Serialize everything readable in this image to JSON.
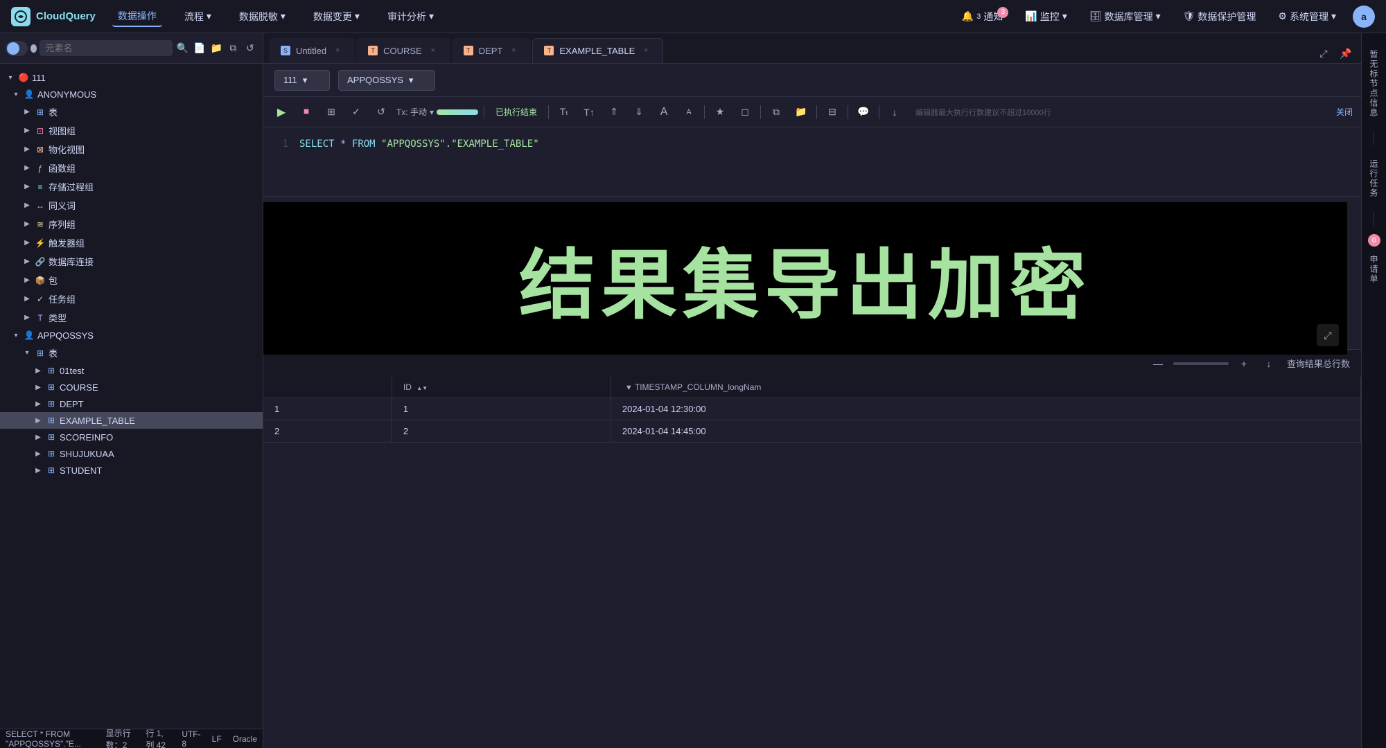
{
  "brand": {
    "name": "CloudQuery",
    "icon_text": "CQ"
  },
  "topnav": {
    "items": [
      {
        "label": "数据操作",
        "active": true
      },
      {
        "label": "流程",
        "dropdown": true
      },
      {
        "label": "数据脱敏",
        "dropdown": true
      },
      {
        "label": "数据变更",
        "dropdown": true
      },
      {
        "label": "审计分析",
        "dropdown": true
      }
    ],
    "right_items": [
      {
        "label": "通知",
        "badge": "3"
      },
      {
        "label": "监控",
        "dropdown": true
      },
      {
        "label": "数据库管理",
        "dropdown": true
      },
      {
        "label": "数据保护管理"
      },
      {
        "label": "系统管理",
        "dropdown": true
      }
    ]
  },
  "sidebar": {
    "search_placeholder": "元素名",
    "tree": [
      {
        "label": "111",
        "level": 0,
        "expanded": true,
        "icon": "db"
      },
      {
        "label": "ANONYMOUS",
        "level": 1,
        "expanded": true,
        "icon": "user"
      },
      {
        "label": "表",
        "level": 2,
        "expanded": false,
        "icon": "table"
      },
      {
        "label": "视图组",
        "level": 2,
        "expanded": false,
        "icon": "view"
      },
      {
        "label": "物化视图",
        "level": 2,
        "expanded": false,
        "icon": "mview"
      },
      {
        "label": "函数组",
        "level": 2,
        "expanded": false,
        "icon": "func"
      },
      {
        "label": "存储过程组",
        "level": 2,
        "expanded": false,
        "icon": "proc"
      },
      {
        "label": "同义词",
        "level": 2,
        "expanded": false,
        "icon": "syn"
      },
      {
        "label": "序列组",
        "level": 2,
        "expanded": false,
        "icon": "seq"
      },
      {
        "label": "触发器组",
        "level": 2,
        "expanded": false,
        "icon": "trig"
      },
      {
        "label": "数据库连接",
        "level": 2,
        "expanded": false,
        "icon": "conn"
      },
      {
        "label": "包",
        "level": 2,
        "expanded": false,
        "icon": "pkg"
      },
      {
        "label": "任务组",
        "level": 2,
        "expanded": false,
        "icon": "task"
      },
      {
        "label": "类型",
        "level": 2,
        "expanded": false,
        "icon": "type"
      },
      {
        "label": "APPQOSSYS",
        "level": 1,
        "expanded": true,
        "icon": "user"
      },
      {
        "label": "表",
        "level": 2,
        "expanded": true,
        "icon": "table"
      },
      {
        "label": "01test",
        "level": 3,
        "icon": "table-item"
      },
      {
        "label": "COURSE",
        "level": 3,
        "icon": "table-item"
      },
      {
        "label": "DEPT",
        "level": 3,
        "icon": "table-item"
      },
      {
        "label": "EXAMPLE_TABLE",
        "level": 3,
        "icon": "table-item"
      },
      {
        "label": "SCOREINFO",
        "level": 3,
        "icon": "table-item"
      },
      {
        "label": "SHUJUKUAA",
        "level": 3,
        "icon": "table-item"
      },
      {
        "label": "STUDENT",
        "level": 3,
        "icon": "table-item"
      }
    ]
  },
  "tabs": [
    {
      "label": "Untitled",
      "active": false,
      "color": "blue"
    },
    {
      "label": "COURSE",
      "active": false,
      "color": "orange"
    },
    {
      "label": "DEPT",
      "active": false,
      "color": "orange"
    },
    {
      "label": "EXAMPLE_TABLE",
      "active": true,
      "color": "orange"
    }
  ],
  "db_selector": {
    "db_value": "111",
    "schema_value": "APPQOSSYS"
  },
  "editor": {
    "tx_label": "Tx: 手动",
    "status": "已执行结束",
    "hint": "编辑器最大执行行数建议不超过10000行",
    "close_label": "关闭",
    "sql": "SELECT * FROM \"APPQOSSYS\".\"EXAMPLE_TABLE\"",
    "line_num": "1"
  },
  "overlay": {
    "text": "结果集导出加密"
  },
  "results_toolbar": {
    "download_label": "↓",
    "query_total_label": "查询结果总行数"
  },
  "table": {
    "headers": [
      "ID",
      "TIMESTAMP_COLUMN_longNam"
    ],
    "rows": [
      {
        "row_num": "1",
        "id": "1",
        "ts": "2024-01-04 12:30:00"
      },
      {
        "row_num": "2",
        "id": "2",
        "ts": "2024-01-04 14:45:00"
      }
    ]
  },
  "status_bar": {
    "sql": "SELECT * FROM \"APPQOSSYS\".\"E...",
    "rows_label": "显示行数：2",
    "position": "行 1, 列 42",
    "encoding": "UTF-8",
    "line_ending": "LF",
    "db_type": "Oracle"
  },
  "right_sidebar": {
    "items": [
      {
        "label": "暂无标节点信息"
      },
      {
        "label": "运行任务"
      },
      {
        "label": "申请单",
        "badge": "0"
      }
    ]
  }
}
